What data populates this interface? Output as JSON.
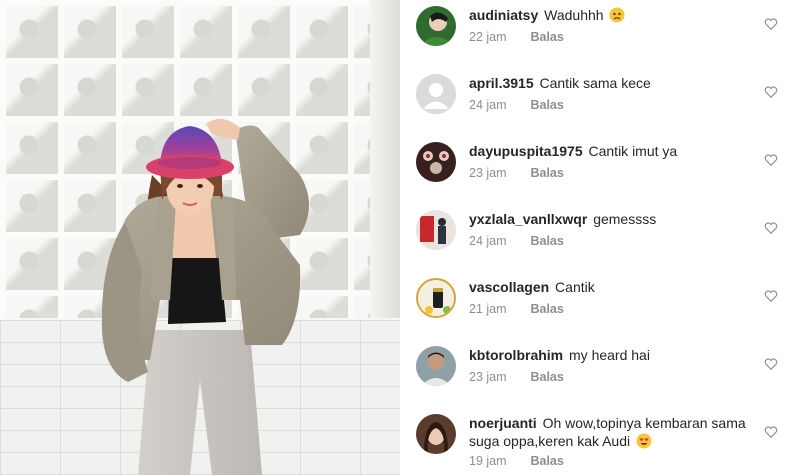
{
  "photo": {
    "alt_icon": "fashion-photo"
  },
  "comments": [
    {
      "username": "audiniatsy",
      "text": "Waduhhh",
      "emoji": "worried-face-emoji",
      "time": "22 jam",
      "reply_label": "Balas",
      "avatar": "green-avatar"
    },
    {
      "username": "april.3915",
      "text": "Cantik sama kece",
      "emoji": "",
      "time": "24 jam",
      "reply_label": "Balas",
      "avatar": "default-avatar"
    },
    {
      "username": "dayupuspita1975",
      "text": "Cantik imut ya",
      "emoji": "",
      "time": "23 jam",
      "reply_label": "Balas",
      "avatar": "dark-avatar"
    },
    {
      "username": "yxzlala_vanllxwqr",
      "text": "gemessss",
      "emoji": "",
      "time": "24 jam",
      "reply_label": "Balas",
      "avatar": "red-avatar"
    },
    {
      "username": "vascollagen",
      "text": "Cantik",
      "emoji": "",
      "time": "21 jam",
      "reply_label": "Balas",
      "avatar": "product-avatar"
    },
    {
      "username": "kbtorolbrahim",
      "text": "my heard hai",
      "emoji": "",
      "time": "23 jam",
      "reply_label": "Balas",
      "avatar": "man-avatar"
    },
    {
      "username": "noerjuanti",
      "text": "Oh wow,topinya kembaran sama suga oppa,keren kak Audi",
      "emoji": "heart-eyes-emoji",
      "time": "19 jam",
      "reply_label": "Balas",
      "avatar": "woman-avatar"
    }
  ],
  "colors": {
    "text": "#262626",
    "secondary": "#8e8e8e",
    "hat_top": "#6a4bb8",
    "hat_bottom": "#d9436f",
    "blazer": "#a59d8c"
  }
}
